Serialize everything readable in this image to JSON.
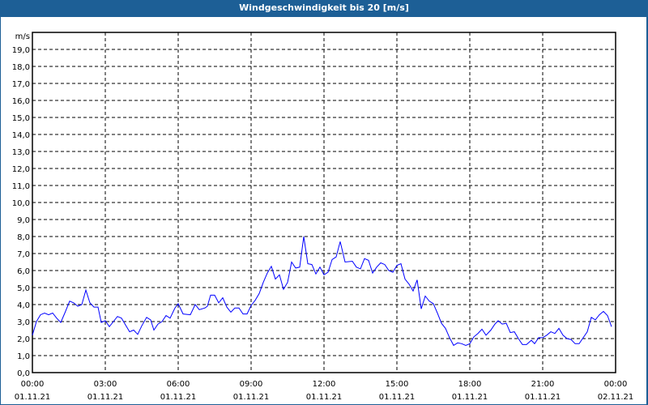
{
  "window": {
    "title": "Windgeschwindigkeit bis 20 [m/s]"
  },
  "colors": {
    "titlebar": "#1d5f96",
    "line": "#0000ff",
    "grid": "#000000"
  },
  "chart_data": {
    "type": "line",
    "title": "Windgeschwindigkeit bis 20 [m/s]",
    "ylabel": "m/s",
    "xlabel": "",
    "ylim": [
      0,
      20
    ],
    "xlim_minutes": [
      0,
      1440
    ],
    "grid": true,
    "y_ticks": [
      "0,0",
      "1,0",
      "2,0",
      "3,0",
      "4,0",
      "5,0",
      "6,0",
      "7,0",
      "8,0",
      "9,0",
      "10,0",
      "11,0",
      "12,0",
      "13,0",
      "14,0",
      "15,0",
      "16,0",
      "17,0",
      "18,0",
      "19,0"
    ],
    "x_ticks": [
      {
        "time": "00:00",
        "date": "01.11.21",
        "minutes": 0
      },
      {
        "time": "03:00",
        "date": "01.11.21",
        "minutes": 180
      },
      {
        "time": "06:00",
        "date": "01.11.21",
        "minutes": 360
      },
      {
        "time": "09:00",
        "date": "01.11.21",
        "minutes": 540
      },
      {
        "time": "12:00",
        "date": "01.11.21",
        "minutes": 720
      },
      {
        "time": "15:00",
        "date": "01.11.21",
        "minutes": 900
      },
      {
        "time": "18:00",
        "date": "01.11.21",
        "minutes": 1080
      },
      {
        "time": "21:00",
        "date": "01.11.21",
        "minutes": 1260
      },
      {
        "time": "00:00",
        "date": "02.11.21",
        "minutes": 1440
      }
    ],
    "series": [
      {
        "name": "Windgeschwindigkeit",
        "x_minutes": [
          0,
          10,
          20,
          30,
          40,
          50,
          60,
          70,
          80,
          92,
          102,
          112,
          122,
          132,
          142,
          152,
          162,
          170,
          180,
          190,
          200,
          210,
          220,
          230,
          240,
          250,
          260,
          270,
          282,
          292,
          300,
          310,
          320,
          330,
          340,
          352,
          360,
          372,
          390,
          402,
          412,
          426,
          432,
          440,
          450,
          460,
          470,
          480,
          490,
          500,
          510,
          520,
          530,
          540,
          550,
          560,
          570,
          580,
          590,
          600,
          610,
          620,
          630,
          640,
          650,
          660,
          670,
          680,
          690,
          700,
          710,
          720,
          730,
          740,
          750,
          760,
          772,
          790,
          800,
          810,
          820,
          830,
          840,
          850,
          860,
          870,
          880,
          890,
          900,
          910,
          920,
          930,
          940,
          950,
          960,
          970,
          980,
          990,
          1000,
          1010,
          1020,
          1030,
          1040,
          1050,
          1060,
          1070,
          1080,
          1090,
          1100,
          1110,
          1120,
          1132,
          1142,
          1150,
          1160,
          1170,
          1180,
          1190,
          1200,
          1210,
          1220,
          1232,
          1240,
          1250,
          1260,
          1270,
          1280,
          1290,
          1300,
          1310,
          1320,
          1330,
          1340,
          1350,
          1360,
          1370,
          1380,
          1390,
          1400,
          1410,
          1420,
          1430
        ],
        "values": [
          2.2,
          3.0,
          3.4,
          3.5,
          3.4,
          3.5,
          3.2,
          2.95,
          3.5,
          4.2,
          4.1,
          3.9,
          4.0,
          4.85,
          4.1,
          3.85,
          3.85,
          2.95,
          3.05,
          2.7,
          3.0,
          3.3,
          3.2,
          2.8,
          2.4,
          2.5,
          2.25,
          2.75,
          3.25,
          3.1,
          2.5,
          2.85,
          3.0,
          3.35,
          3.2,
          3.8,
          4.05,
          3.45,
          3.4,
          4.0,
          3.7,
          3.8,
          3.9,
          4.55,
          4.55,
          4.1,
          4.4,
          3.85,
          3.55,
          3.8,
          3.8,
          3.45,
          3.45,
          3.95,
          4.25,
          4.65,
          5.3,
          5.85,
          6.25,
          5.5,
          5.75,
          4.9,
          5.3,
          6.5,
          6.15,
          6.2,
          8.0,
          6.4,
          6.35,
          5.8,
          6.2,
          5.75,
          5.9,
          6.65,
          6.8,
          7.7,
          6.5,
          6.55,
          6.2,
          6.1,
          6.7,
          6.6,
          5.85,
          6.2,
          6.45,
          6.35,
          6.0,
          5.9,
          6.3,
          6.4,
          5.5,
          5.2,
          4.8,
          5.45,
          3.75,
          4.5,
          4.2,
          4.05,
          3.5,
          2.9,
          2.6,
          2.05,
          1.6,
          1.75,
          1.7,
          1.6,
          1.7,
          2.1,
          2.3,
          2.55,
          2.2,
          2.5,
          2.85,
          3.05,
          2.85,
          2.9,
          2.35,
          2.4,
          2.0,
          1.65,
          1.65,
          1.9,
          1.7,
          2.05,
          2.05,
          2.2,
          2.4,
          2.3,
          2.6,
          2.2,
          2.0,
          1.95,
          1.7,
          1.7,
          2.05,
          2.4,
          3.25,
          3.1,
          3.4,
          3.6,
          3.35,
          2.7
        ]
      }
    ]
  }
}
